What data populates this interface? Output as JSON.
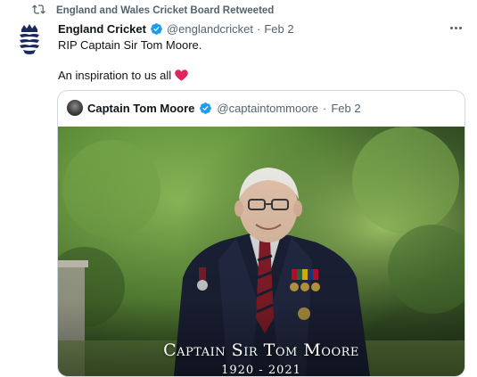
{
  "retweet": {
    "label": "England and Wales Cricket Board Retweeted",
    "icon": "retweet-icon"
  },
  "tweet": {
    "display_name": "England Cricket",
    "handle": "@englandcricket",
    "separator": "·",
    "date": "Feb 2",
    "text_line_1": "RIP Captain Sir Tom Moore.",
    "text_line_2": "An inspiration to us all",
    "emoji": "heart-emoji",
    "avatar_icon": "ecb-crest-icon"
  },
  "quote": {
    "display_name": "Captain Tom Moore",
    "handle": "@captaintommoore",
    "separator": "·",
    "date": "Feb 2",
    "image": {
      "caption_title": "Captain Sir Tom Moore",
      "caption_years": "1920 - 2021"
    }
  },
  "colors": {
    "text_primary": "#0f1419",
    "text_secondary": "#536471",
    "verified": "#1d9bf0",
    "heart": "#e0245e",
    "border": "#cfd9de"
  }
}
